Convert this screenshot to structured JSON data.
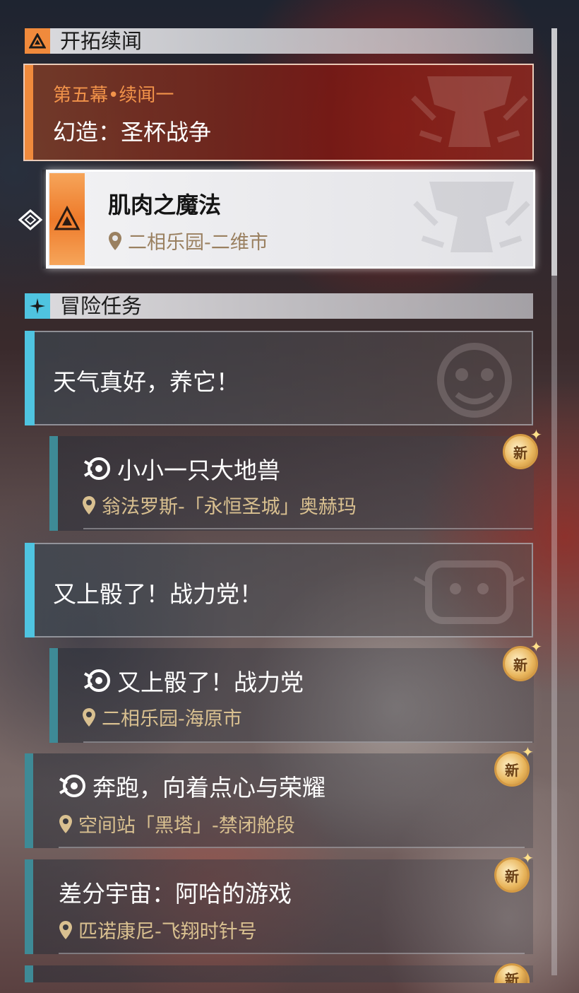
{
  "sections": {
    "trailblaze": {
      "title": "开拓续闻"
    },
    "adventure": {
      "title": "冒险任务"
    }
  },
  "trailblaze_card": {
    "subtitle": "第五幕•续闻一",
    "title": "幻造：圣杯战争"
  },
  "selected_quest": {
    "title": "肌肉之魔法",
    "location": "二相乐园-二维市"
  },
  "groups": [
    {
      "title": "天气真好，养它！"
    },
    {
      "title": "又上骰了！战力党！"
    }
  ],
  "quests": [
    {
      "title": "小小一只大地兽",
      "location": "翁法罗斯-「永恒圣城」奥赫玛",
      "badge": "新"
    },
    {
      "title": "又上骰了！战力党",
      "location": "二相乐园-海原市",
      "badge": "新"
    },
    {
      "title": "奔跑，向着点心与荣耀",
      "location": "空间站「黑塔」-禁闭舱段",
      "badge": "新"
    },
    {
      "title": "差分宇宙：阿哈的游戏",
      "location": "匹诺康尼-飞翔时针号",
      "badge": "新"
    },
    {
      "badge": "新"
    }
  ],
  "colors": {
    "trailblaze_accent": "#f08a3c",
    "adventure_accent": "#4fc4e0",
    "quest_bar": "#3e8a96",
    "location_text": "#d9c090",
    "badge_gold": "#e8b45a"
  },
  "icons": {
    "trailblaze_section": "trailblaze-triangle-icon",
    "adventure_section": "sparkle-icon",
    "quest_type": "pom-pom-icon",
    "location": "map-pin-icon",
    "pointer": "diamond-arrow-icon"
  }
}
